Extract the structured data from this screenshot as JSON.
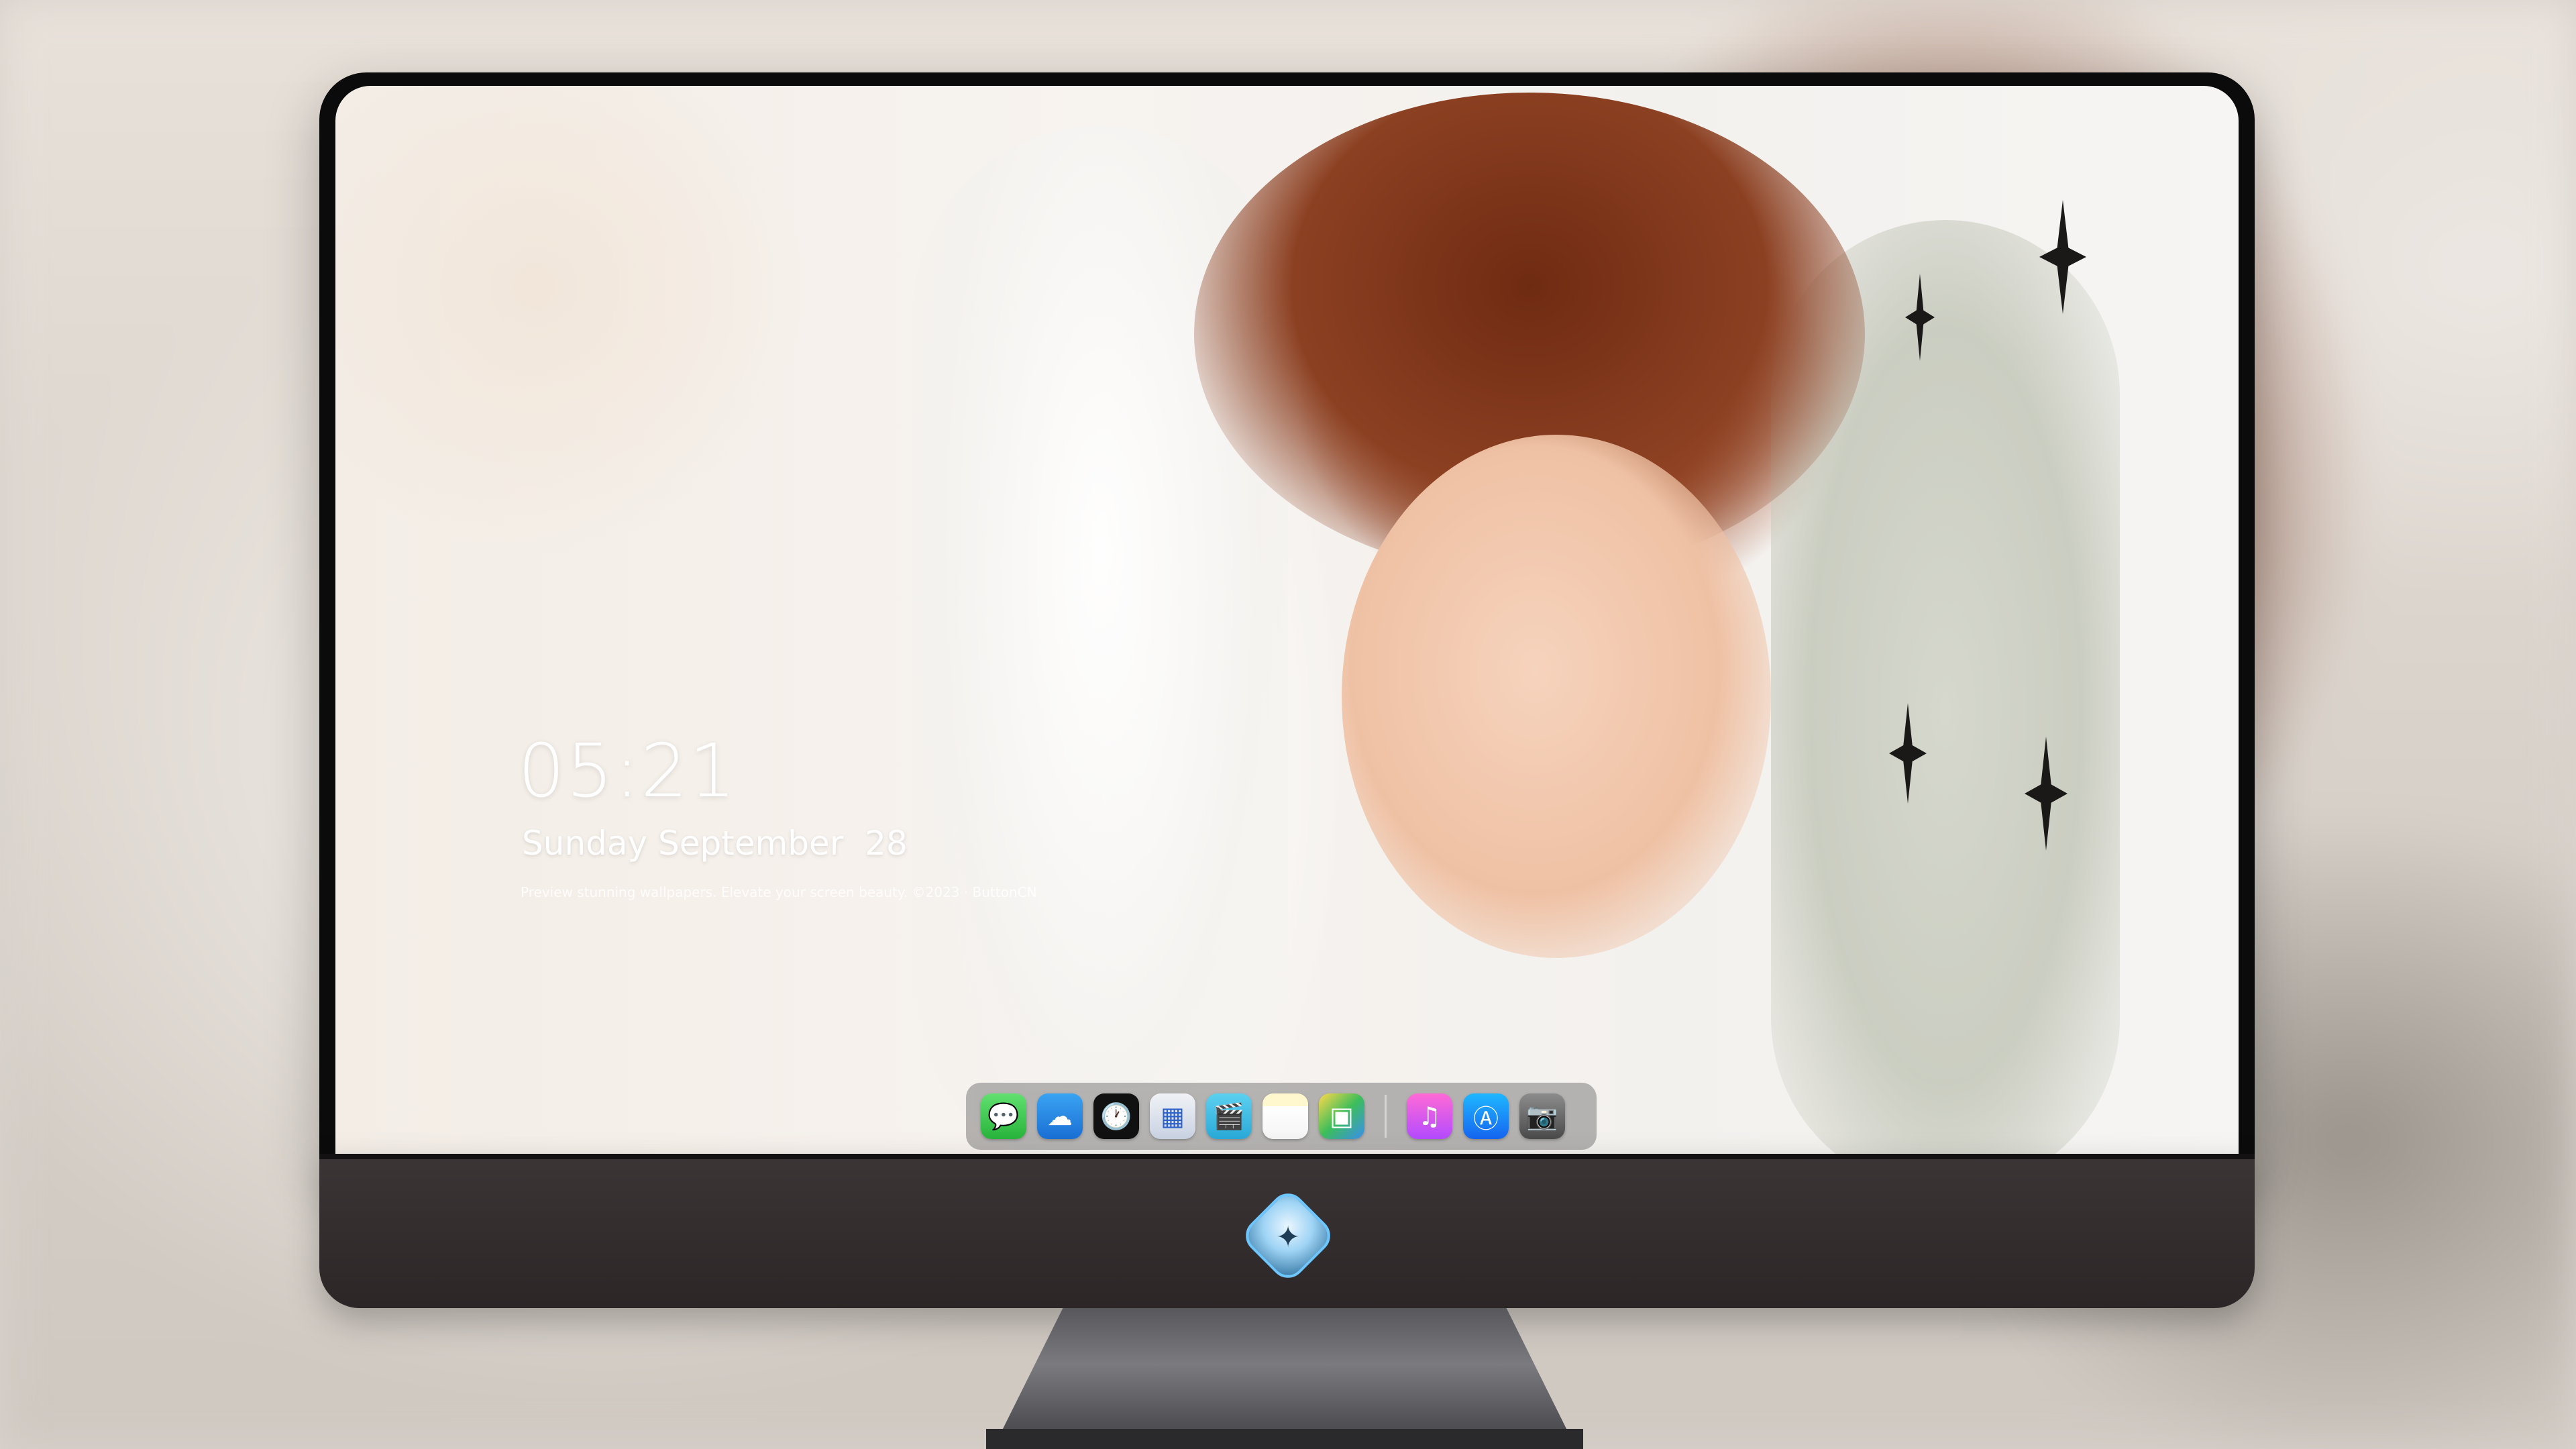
{
  "lock_screen": {
    "time": "05:21",
    "date": "Sunday September  28",
    "caption": "Preview stunning wallpapers. Elevate your screen beauty. ©2023 · ButtonCN"
  },
  "dock": {
    "apps": [
      {
        "name": "Messages",
        "icon": "message-bubble-icon",
        "glyph": "💬"
      },
      {
        "name": "Weather",
        "icon": "cloud-icon",
        "glyph": "☁"
      },
      {
        "name": "Clock",
        "icon": "clock-icon",
        "glyph": "🕐"
      },
      {
        "name": "Preview",
        "icon": "preview-icon",
        "glyph": "▦"
      },
      {
        "name": "Clips",
        "icon": "clapperboard-icon",
        "glyph": "🎬"
      },
      {
        "name": "Notes",
        "icon": "notes-icon",
        "glyph": ""
      },
      {
        "name": "Photos",
        "icon": "photo-gallery-icon",
        "glyph": "▣"
      },
      {
        "name": "Music",
        "icon": "music-note-icon",
        "glyph": "♫"
      },
      {
        "name": "App Store",
        "icon": "app-store-icon",
        "glyph": "Ⓐ"
      },
      {
        "name": "Camera",
        "icon": "camera-icon",
        "glyph": "📷"
      }
    ]
  },
  "colors": {
    "dock_bg": "#5a5a5a",
    "chin": "#3c3536",
    "bezel": "#0c0b0b"
  }
}
